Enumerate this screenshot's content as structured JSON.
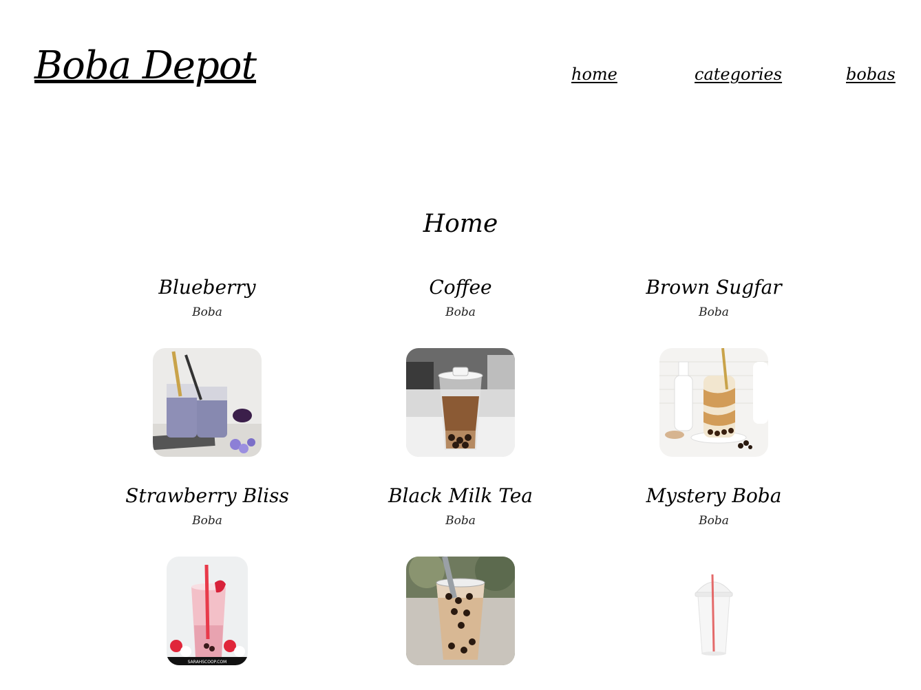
{
  "header": {
    "logo": "Boba Depot",
    "nav": [
      {
        "label": "home"
      },
      {
        "label": "categories"
      },
      {
        "label": "bobas"
      }
    ]
  },
  "main": {
    "title": "Home",
    "items": [
      {
        "name": "Blueberry",
        "category": "Boba",
        "image_icon": "blueberry-boba-photo"
      },
      {
        "name": "Coffee",
        "category": "Boba",
        "image_icon": "coffee-boba-photo"
      },
      {
        "name": "Brown Sugfar",
        "category": "Boba",
        "image_icon": "brown-sugar-boba-photo"
      },
      {
        "name": "Strawberry Bliss",
        "category": "Boba",
        "image_icon": "strawberry-boba-photo"
      },
      {
        "name": "Black Milk Tea",
        "category": "Boba",
        "image_icon": "black-milk-tea-photo"
      },
      {
        "name": "Mystery Boba",
        "category": "Boba",
        "image_icon": "empty-cup-photo"
      }
    ]
  },
  "colors": {
    "background": "#ffffff",
    "text": "#000000"
  }
}
